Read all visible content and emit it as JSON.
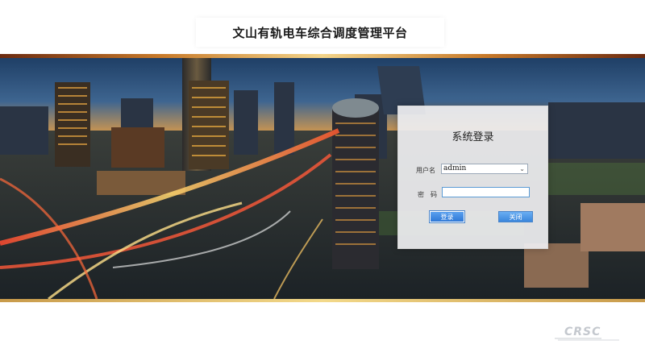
{
  "header": {
    "title": "文山有轨电车综合调度管理平台"
  },
  "login": {
    "title": "系统登录",
    "username_label": "用户名",
    "username_value": "admin",
    "password_label": "密　码",
    "login_button": "登录",
    "close_button": "关闭"
  },
  "footer": {
    "logo_text": "CRSC"
  },
  "icons": {
    "dropdown": "chevron-down-icon"
  },
  "colors": {
    "accent_blue": "#3a86dc",
    "gold": "#d9a654"
  }
}
